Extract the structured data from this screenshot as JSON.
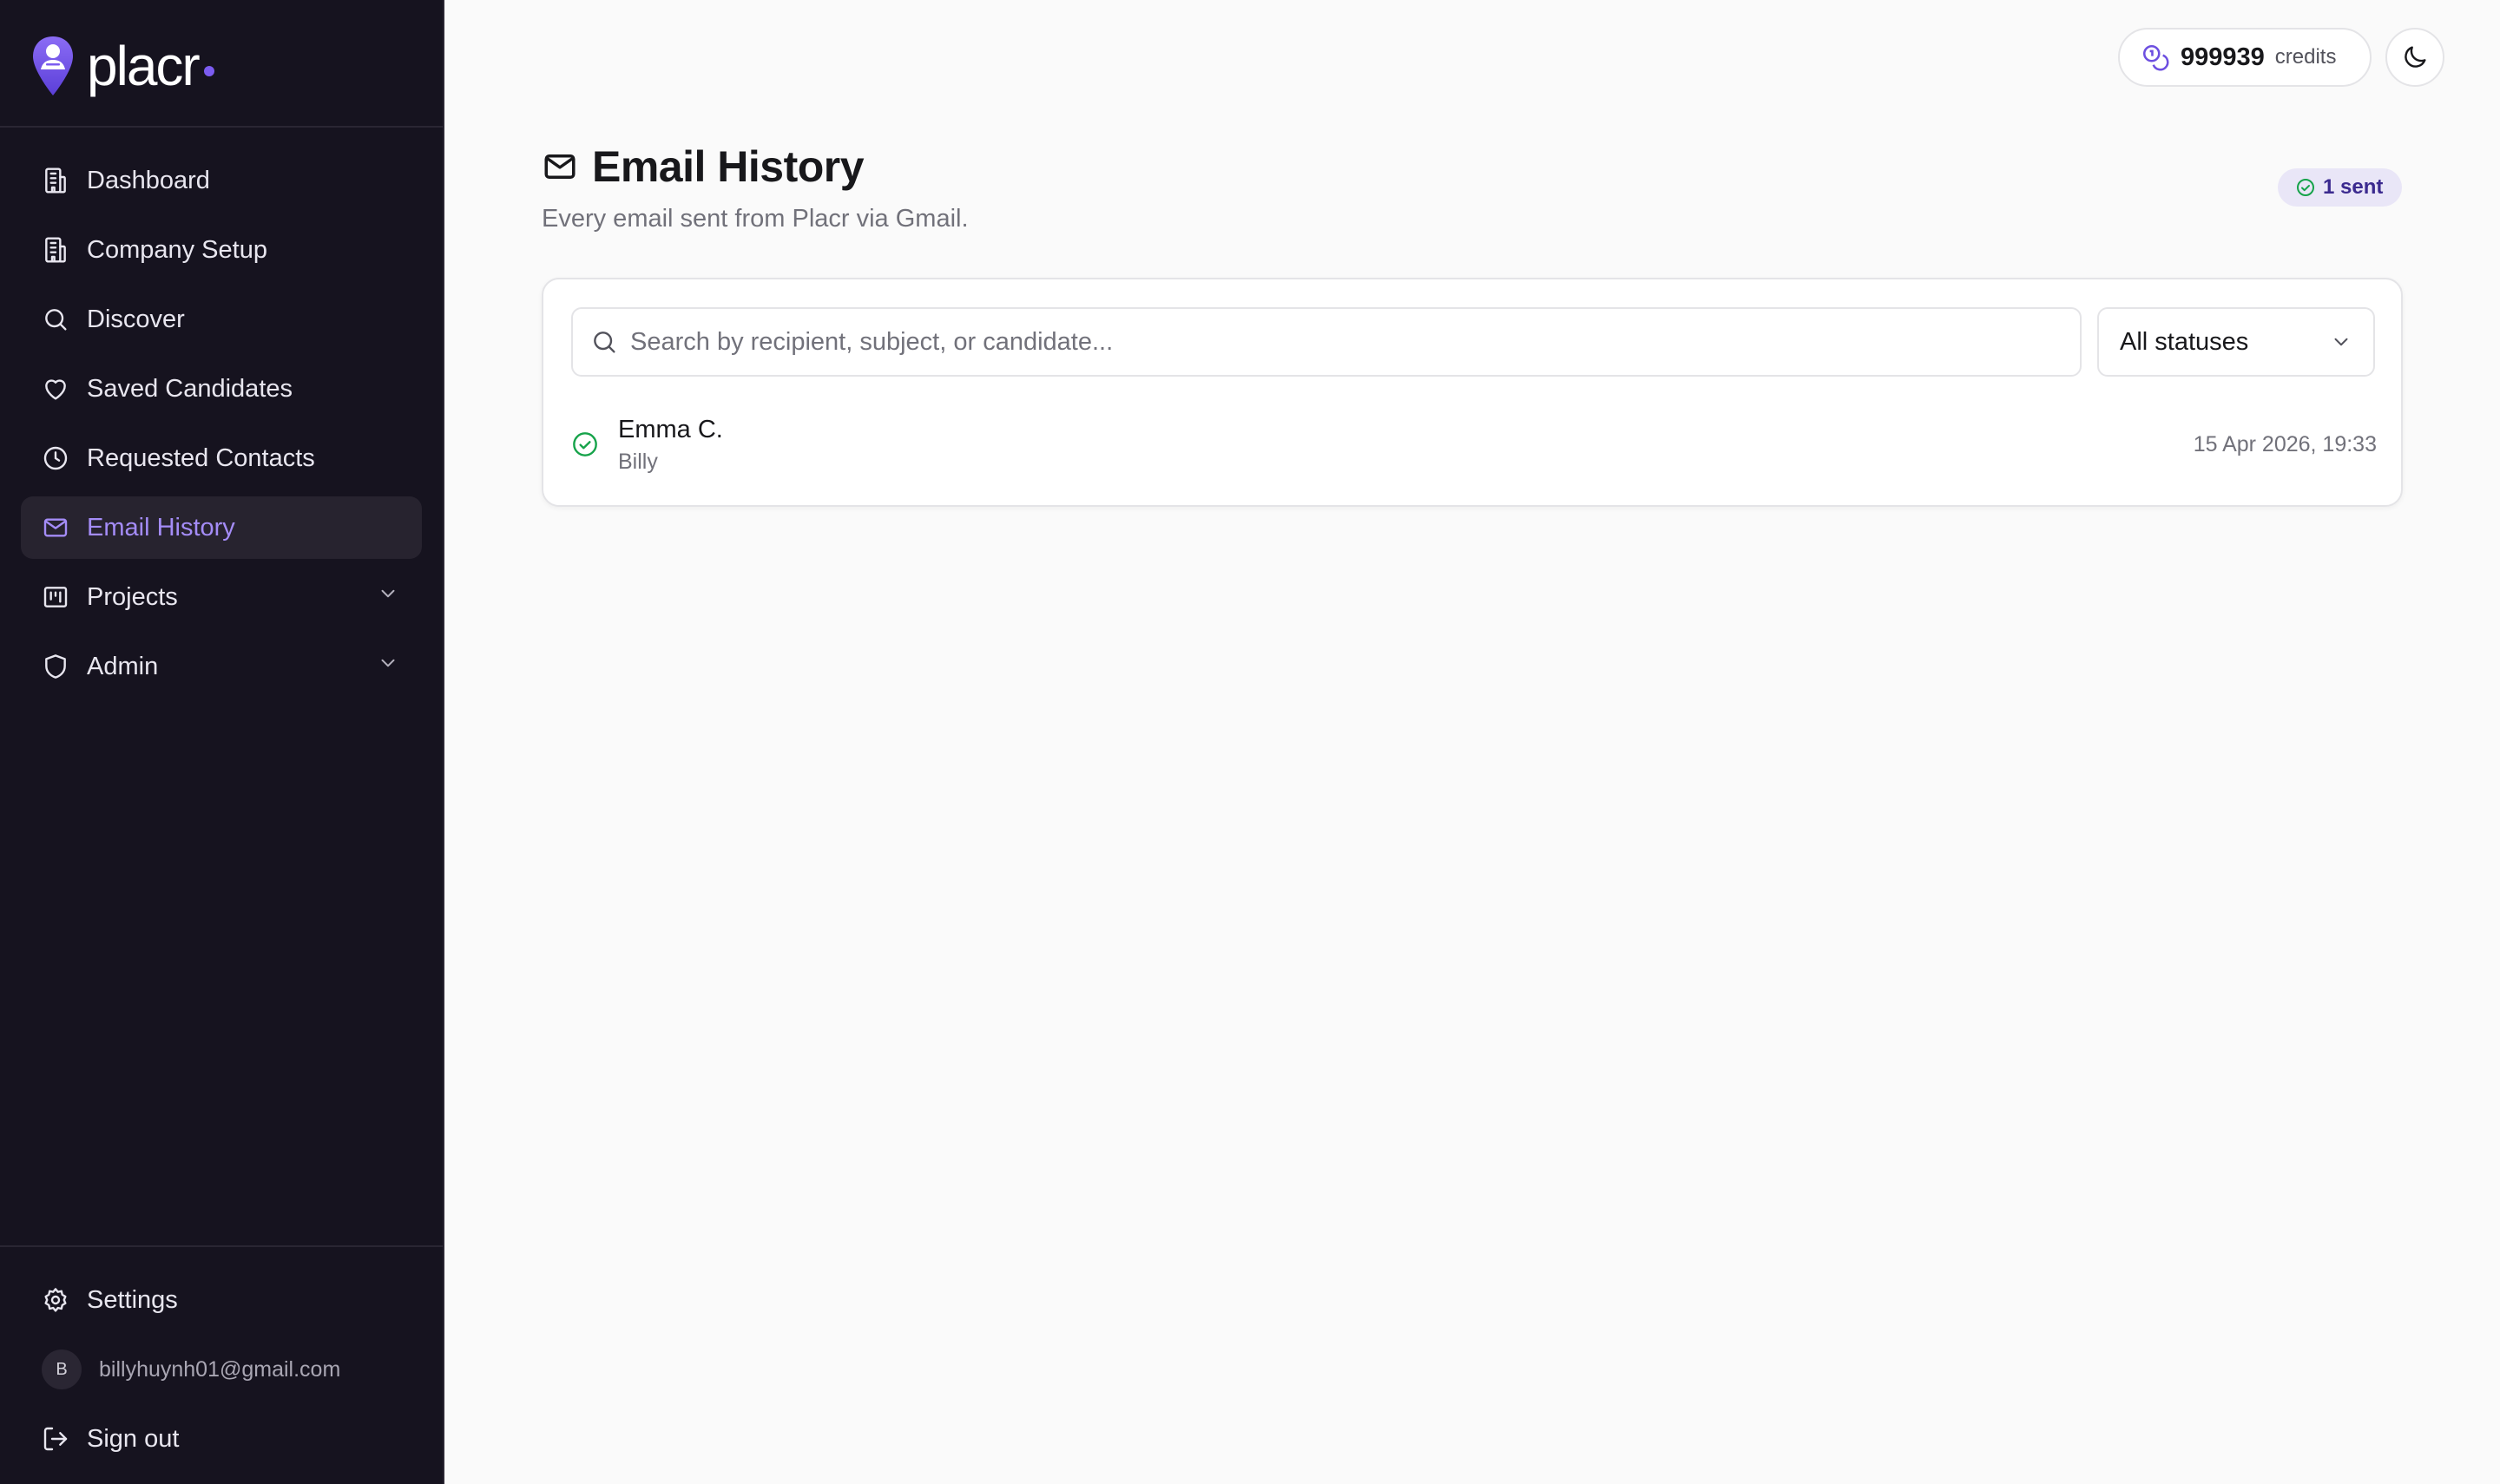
{
  "brand": {
    "name": "placr",
    "accent_color": "#7c5cf0",
    "icon": "location-pin-person-icon"
  },
  "sidebar": {
    "items": [
      {
        "label": "Dashboard",
        "icon": "building-icon",
        "active": false
      },
      {
        "label": "Company Setup",
        "icon": "building-icon",
        "active": false
      },
      {
        "label": "Discover",
        "icon": "search-icon",
        "active": false
      },
      {
        "label": "Saved Candidates",
        "icon": "heart-icon",
        "active": false
      },
      {
        "label": "Requested Contacts",
        "icon": "clock-icon",
        "active": false
      },
      {
        "label": "Email History",
        "icon": "mail-icon",
        "active": true
      },
      {
        "label": "Projects",
        "icon": "kanban-icon",
        "active": false,
        "expandable": true
      },
      {
        "label": "Admin",
        "icon": "shield-icon",
        "active": false,
        "expandable": true
      }
    ],
    "bottom": {
      "settings_label": "Settings",
      "user_initial": "B",
      "user_email": "billyhuynh01@gmail.com",
      "signout_label": "Sign out"
    }
  },
  "topbar": {
    "credits_value": "999939",
    "credits_label": "credits",
    "theme_icon": "moon-icon"
  },
  "header": {
    "title": "Email History",
    "subtitle": "Every email sent from Placr via Gmail.",
    "badge": "1 sent"
  },
  "filters": {
    "search_placeholder": "Search by recipient, subject, or candidate...",
    "search_value": "",
    "status_selected": "All statuses"
  },
  "emails": [
    {
      "recipient": "Emma C.",
      "candidate": "Billy",
      "timestamp": "15 Apr 2026, 19:33",
      "status": "sent",
      "status_color": "#16a34a"
    }
  ]
}
